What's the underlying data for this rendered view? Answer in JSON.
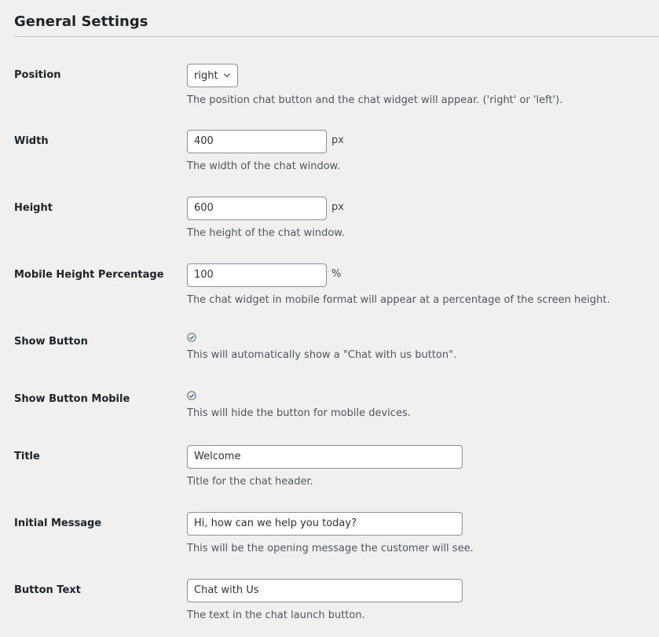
{
  "section": {
    "title": "General Settings"
  },
  "colors": {
    "background": "#f0f0f1",
    "border": "#8c8f94",
    "text": "#1d2327",
    "description": "#50575e",
    "check": "#2271b1"
  },
  "fields": {
    "position": {
      "label": "Position",
      "value": "right",
      "icon": "chevron-down-icon",
      "description": "The position chat button and the chat widget will appear. ('right' or 'left')."
    },
    "width": {
      "label": "Width",
      "value": "400",
      "unit": "px",
      "description": "The width of the chat window."
    },
    "height": {
      "label": "Height",
      "value": "600",
      "unit": "px",
      "description": "The height of the chat window."
    },
    "mobile_height": {
      "label": "Mobile Height Percentage",
      "value": "100",
      "unit": "%",
      "description": "The chat widget in mobile format will appear at a percentage of the screen height."
    },
    "show_button": {
      "label": "Show Button",
      "checked": true,
      "icon": "checkmark-icon",
      "description": "This will automatically show a \"Chat with us button\"."
    },
    "show_button_mobile": {
      "label": "Show Button Mobile",
      "checked": true,
      "icon": "checkmark-icon",
      "description": "This will hide the button for mobile devices."
    },
    "title": {
      "label": "Title",
      "value": "Welcome",
      "description": "Title for the chat header."
    },
    "initial_message": {
      "label": "Initial Message",
      "value": "Hi, how can we help you today?",
      "description": "This will be the opening message the customer will see."
    },
    "button_text": {
      "label": "Button Text",
      "value": "Chat with Us",
      "description": "The text in the chat launch button."
    }
  }
}
